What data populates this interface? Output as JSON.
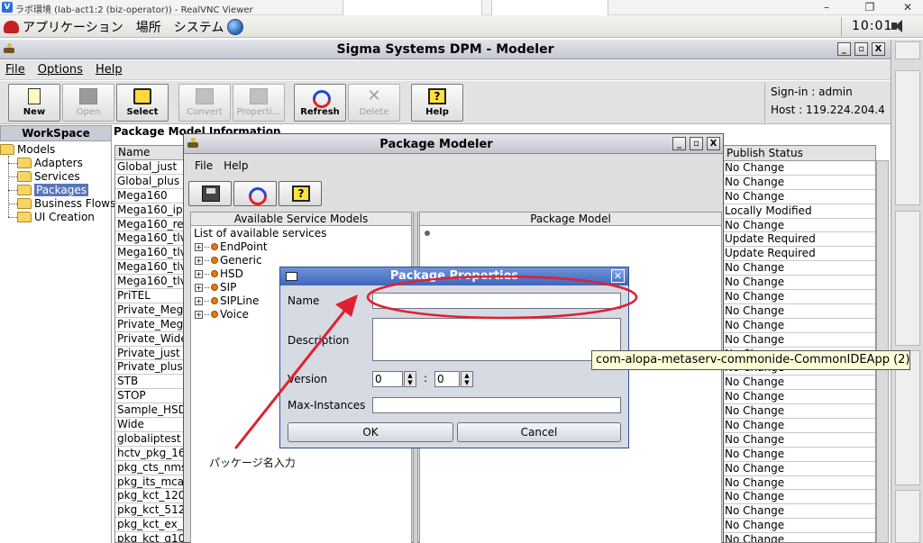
{
  "vnc": {
    "title": "ラボ環境 (lab-act1:2 (biz-operator)) - RealVNC Viewer",
    "icon_letter": "V",
    "controls": [
      "–",
      "❐",
      "✕"
    ]
  },
  "gnome_panel": {
    "menus": [
      "アプリケーション",
      "場所",
      "システム"
    ],
    "clock": "10:01"
  },
  "main_window": {
    "title": "Sigma Systems DPM - Modeler",
    "window_buttons": [
      "_",
      "▫",
      "X"
    ],
    "menu": [
      "File",
      "Options",
      "Help"
    ],
    "toolbar": [
      {
        "label": "New",
        "enabled": true
      },
      {
        "label": "Open",
        "enabled": false
      },
      {
        "label": "Select",
        "enabled": true
      },
      {
        "label": "Convert",
        "enabled": false
      },
      {
        "label": "Properti...",
        "enabled": false
      },
      {
        "label": "Refresh",
        "enabled": true
      },
      {
        "label": "Delete",
        "enabled": false
      },
      {
        "label": "Help",
        "enabled": true
      }
    ],
    "signin": {
      "user_line": "Sign-in : admin",
      "host_line": "Host : 119.224.204.4"
    }
  },
  "workspace": {
    "header": "WorkSpace",
    "root": "Models",
    "children": [
      "Adapters",
      "Services",
      "Packages",
      "Business Flows",
      "UI Creation"
    ],
    "selected": "Packages"
  },
  "package_info": {
    "header": "Package Model Information",
    "name_column": "Name",
    "names": [
      "Global_just",
      "Global_plus",
      "Mega160",
      "Mega160_ip",
      "Mega160_re",
      "Mega160_tlv",
      "Mega160_tlv",
      "Mega160_tlv",
      "Mega160_tlv",
      "PriTEL",
      "Private_Mega",
      "Private_Mega",
      "Private_Wide",
      "Private_just",
      "Private_plus",
      "STB",
      "STOP",
      "Sample_HSD",
      "Wide",
      "globaliptest",
      "hctv_pkg_16",
      "pkg_cts_nms",
      "pkg_its_mca",
      "pkg_kct_120",
      "pkg_kct_512",
      "pkg_kct_ex_",
      "pkg_kct_g10"
    ],
    "status_column": "Publish Status",
    "statuses": [
      "No Change",
      "No Change",
      "No Change",
      "Locally Modified",
      "No Change",
      "Update Required",
      "Update Required",
      "No Change",
      "No Change",
      "No Change",
      "No Change",
      "No Change",
      "No Change",
      "No Change",
      "No Change",
      "No Change",
      "No Change",
      "No Change",
      "No Change",
      "No Change",
      "No Change",
      "No Change",
      "No Change",
      "No Change",
      "No Change",
      "No Change",
      "No Change"
    ]
  },
  "package_modeler": {
    "title": "Package Modeler",
    "menu": [
      "File",
      "Help"
    ],
    "available_header": "Available Service Models",
    "available_root": "List of available services",
    "services": [
      "EndPoint",
      "Generic",
      "HSD",
      "SIP",
      "SIPLine",
      "Voice"
    ],
    "model_header": "Package Model"
  },
  "package_properties": {
    "title": "Package Properties",
    "name_label": "Name",
    "name_value": "",
    "description_label": "Description",
    "description_value": "",
    "version_label": "Version",
    "version_major": "0",
    "version_sep": ":",
    "version_minor": "0",
    "max_instances_label": "Max-Instances",
    "max_instances_value": "",
    "ok_label": "OK",
    "cancel_label": "Cancel"
  },
  "tooltip": "com-alopa-metaserv-commonide-CommonIDEApp (2)",
  "annotation": {
    "text": "パッケージ名入力",
    "color": "#e02030"
  },
  "colors": {
    "selection": "#5b76b6",
    "dialog_title": "#3f67bb",
    "annotation": "#e02030",
    "tooltip_bg": "#ffffd8"
  }
}
